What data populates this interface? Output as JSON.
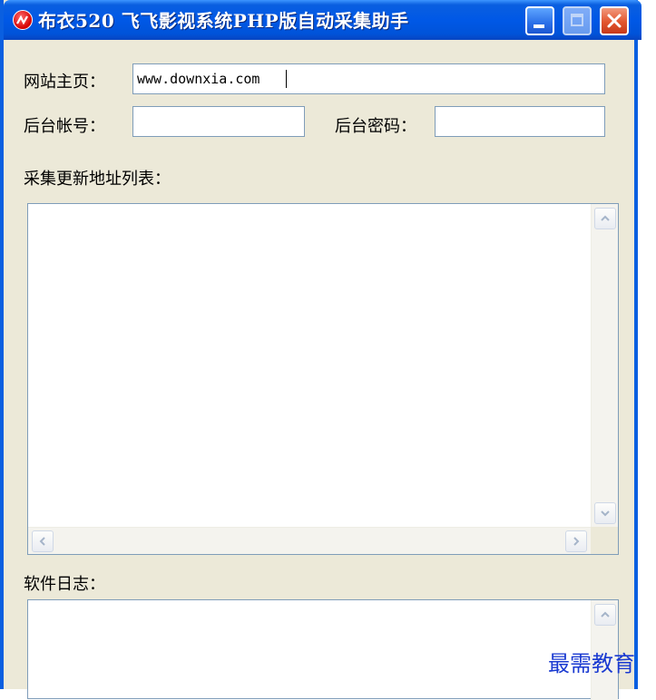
{
  "window": {
    "title": "布衣520 飞飞影视系统PHP版自动采集助手",
    "title_bar_color": "#0a5fe0",
    "app_icon": "red-circle-app-icon",
    "controls": [
      "minimize-icon",
      "maximize-icon",
      "close-icon"
    ]
  },
  "form": {
    "homepage_label": "网站主页：",
    "homepage_value": "www.downxia.com",
    "account_label": "后台帐号：",
    "account_value": "",
    "password_label": "后台密码：",
    "password_value": ""
  },
  "url_list": {
    "label": "采集更新地址列表：",
    "content": ""
  },
  "log": {
    "label": "软件日志：",
    "content": ""
  },
  "watermark": "最需教育"
}
